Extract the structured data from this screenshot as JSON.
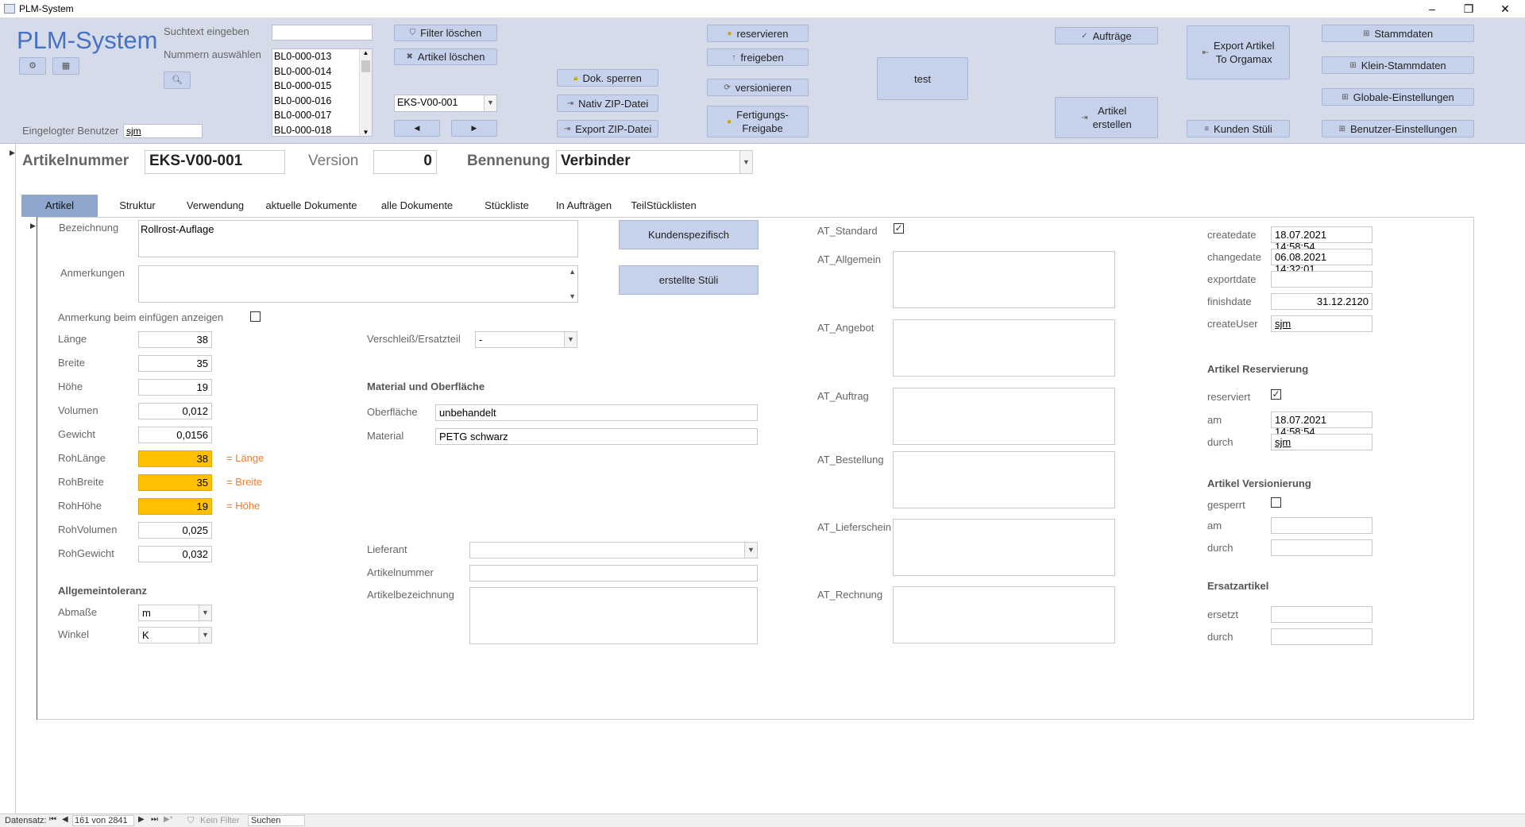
{
  "window": {
    "title": "PLM-System",
    "minimize": "–",
    "restore": "❐",
    "close": "✕"
  },
  "header": {
    "logo": "PLM-System",
    "search_label": "Suchtext eingeben",
    "search_value": "",
    "numbers_label": "Nummern auswählen",
    "numbers": [
      "BL0-000-013",
      "BL0-000-014",
      "BL0-000-015",
      "BL0-000-016",
      "BL0-000-017",
      "BL0-000-018"
    ],
    "user_label": "Eingelogter Benutzer",
    "user_value": "sjm",
    "article_combo": "EKS-V00-001",
    "buttons": {
      "filter_clear": "Filter löschen",
      "article_delete": "Artikel löschen",
      "lock_docs": "Dok. sperren",
      "native_zip": "Nativ ZIP-Datei",
      "export_zip": "Export ZIP-Datei",
      "reserve": "reservieren",
      "release": "freigeben",
      "version": "versionieren",
      "production_release": "Fertigungs-\nFreigabe",
      "test": "test",
      "orders": "Aufträge",
      "create_article": "Artikel\nerstellen",
      "export_orgamax": "Export Artikel\nTo Orgamax",
      "customer_bom": "Kunden Stüli",
      "master_data": "Stammdaten",
      "small_master_data": "Klein-Stammdaten",
      "global_settings": "Globale-Einstellungen",
      "user_settings": "Benutzer-Einstellungen"
    }
  },
  "record": {
    "article_no_label": "Artikelnummer",
    "article_no": "EKS-V00-001",
    "version_label": "Version",
    "version": "0",
    "name_label": "Bennenung",
    "name": "Verbinder"
  },
  "tabs": [
    "Artikel",
    "Struktur",
    "Verwendung",
    "aktuelle Dokumente",
    "alle Dokumente",
    "Stückliste",
    "In Aufträgen",
    "TeilStücklisten"
  ],
  "article": {
    "bezeichnung_label": "Bezeichnung",
    "bezeichnung": "Rollrost-Auflage",
    "anmerkungen_label": "Anmerkungen",
    "anmerkungen": "",
    "anmerkung_show_label": "Anmerkung beim einfügen anzeigen",
    "dims": [
      {
        "label": "Länge",
        "value": "38"
      },
      {
        "label": "Breite",
        "value": "35"
      },
      {
        "label": "Höhe",
        "value": "19"
      },
      {
        "label": "Volumen",
        "value": "0,012"
      },
      {
        "label": "Gewicht",
        "value": "0,0156"
      }
    ],
    "raw": [
      {
        "label": "RohLänge",
        "value": "38",
        "note": "= Länge"
      },
      {
        "label": "RohBreite",
        "value": "35",
        "note": "= Breite"
      },
      {
        "label": "RohHöhe",
        "value": "19",
        "note": "= Höhe"
      }
    ],
    "raw_volume_label": "RohVolumen",
    "raw_volume": "0,025",
    "raw_weight_label": "RohGewicht",
    "raw_weight": "0,032",
    "tolerance_title": "Allgemeintoleranz",
    "abmasse_label": "Abmaße",
    "abmasse": "m",
    "winkel_label": "Winkel",
    "winkel": "K",
    "wear_label": "Verschleiß/Ersatzteil",
    "wear_value": "-",
    "material_title": "Material und Oberfläche",
    "surface_label": "Oberfläche",
    "surface": "unbehandelt",
    "material_label": "Material",
    "material": "PETG schwarz",
    "supplier_label": "Lieferant",
    "supplier": "",
    "supplier_artno_label": "Artikelnummer",
    "supplier_artno": "",
    "supplier_desc_label": "Artikelbezeichnung",
    "supplier_desc": "",
    "btn_custom": "Kundenspezifisch",
    "btn_created_bom": "erstellte Stüli",
    "at_standard_label": "AT_Standard",
    "at_fields": [
      "AT_Allgemein",
      "AT_Angebot",
      "AT_Auftrag",
      "AT_Bestellung",
      "AT_Lieferschein",
      "AT_Rechnung"
    ]
  },
  "meta": {
    "createdate_label": "createdate",
    "createdate": "18.07.2021 14:58:54",
    "changedate_label": "changedate",
    "changedate": "06.08.2021 14:32:01",
    "exportdate_label": "exportdate",
    "exportdate": "",
    "finishdate_label": "finishdate",
    "finishdate": "31.12.2120",
    "createuser_label": "createUser",
    "createuser": "sjm",
    "reservation_title": "Artikel Reservierung",
    "reserved_label": "reserviert",
    "res_am_label": "am",
    "res_am": "18.07.2021 14:58:54",
    "res_by_label": "durch",
    "res_by": "sjm",
    "versioning_title": "Artikel Versionierung",
    "locked_label": "gesperrt",
    "ver_am_label": "am",
    "ver_am": "",
    "ver_by_label": "durch",
    "ver_by": "",
    "replacement_title": "Ersatzartikel",
    "replaced_label": "ersetzt",
    "replaced": "",
    "rep_by_label": "durch",
    "rep_by": ""
  },
  "statusbar": {
    "record_label": "Datensatz:",
    "record_pos": "161 von 2841",
    "filter": "Kein Filter",
    "search": "Suchen"
  }
}
